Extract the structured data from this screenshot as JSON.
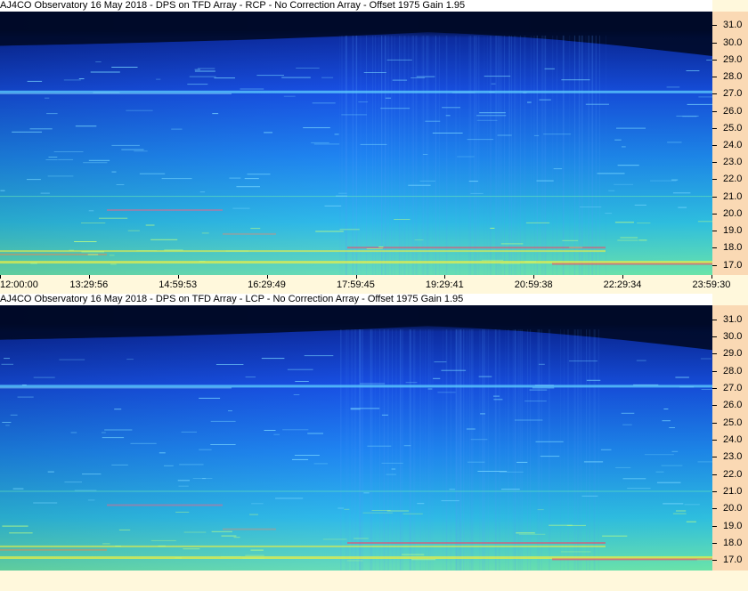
{
  "chart_data": [
    {
      "type": "heatmap",
      "title": "AJ4CO Observatory 16 May 2018 - DPS on TFD Array  - RCP  -  No Correction Array  -  Offset 1975  Gain 1.95",
      "y_ticks": [
        "31.0",
        "30.0",
        "29.0",
        "28.0",
        "27.0",
        "26.0",
        "25.0",
        "24.0",
        "23.0",
        "22.0",
        "21.0",
        "20.0",
        "19.0",
        "18.0",
        "17.0"
      ],
      "y_tick_values": [
        31,
        30,
        29,
        28,
        27,
        26,
        25,
        24,
        23,
        22,
        21,
        20,
        19,
        18,
        17
      ],
      "ylim": [
        16.4,
        31.8
      ],
      "x_ticks": [
        "12:00:00",
        "13:29:56",
        "14:59:53",
        "16:29:49",
        "17:59:45",
        "19:29:41",
        "20:59:38",
        "22:29:34",
        "23:59:30"
      ],
      "colors": [
        "#000a28",
        "#0a2a9a",
        "#1650e0",
        "#1e8cf0",
        "#30c8e8",
        "#70f0b0",
        "#f0f040",
        "#ff4060"
      ]
    },
    {
      "type": "heatmap",
      "title": "AJ4CO Observatory 16 May 2018 - DPS on TFD Array  - LCP  -  No Correction Array  -  Offset 1975  Gain 1.95",
      "y_ticks": [
        "31.0",
        "30.0",
        "29.0",
        "28.0",
        "27.0",
        "26.0",
        "25.0",
        "24.0",
        "23.0",
        "22.0",
        "21.0",
        "20.0",
        "19.0",
        "18.0",
        "17.0"
      ],
      "y_tick_values": [
        31,
        30,
        29,
        28,
        27,
        26,
        25,
        24,
        23,
        22,
        21,
        20,
        19,
        18,
        17
      ],
      "ylim": [
        16.4,
        31.8
      ],
      "x_ticks": [],
      "colors": [
        "#000a28",
        "#0a2a9a",
        "#1650e0",
        "#1e8cf0",
        "#30c8e8",
        "#70f0b0",
        "#f0f040",
        "#ff4060"
      ]
    }
  ]
}
